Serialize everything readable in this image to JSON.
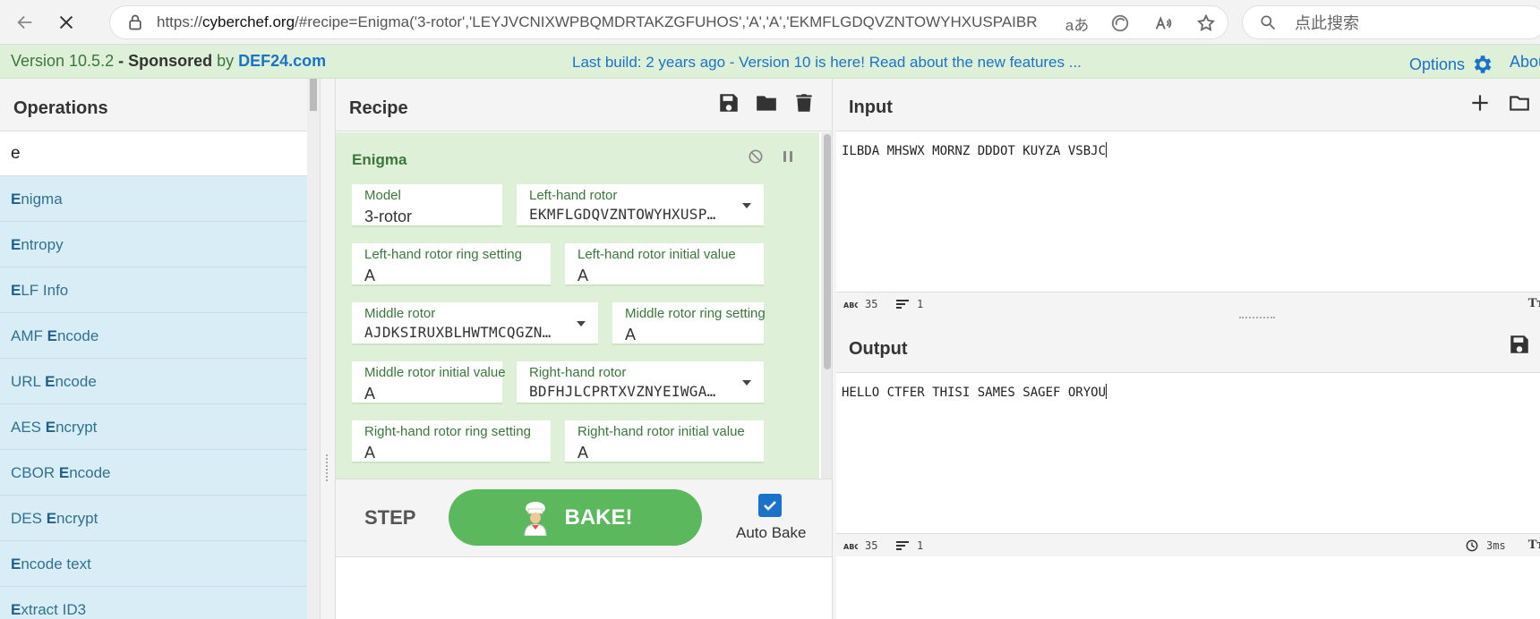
{
  "browser": {
    "url_prefix": "https://",
    "url_host": "cyberchef.org",
    "url_rest": "/#recipe=Enigma('3-rotor','LEYJVCNIXWPBQMDRTAKZGFUHOS','A','A','EKMFLGDQVZNTOWYHXUSPAIBR...",
    "translate_label": "aあ",
    "search_placeholder": "点此搜索"
  },
  "banner": {
    "version": "Version 10.5.2",
    "sponsored": " - Sponsored",
    "by": " by ",
    "sponsor": "DEF24.com",
    "build_notice": "Last build: 2 years ago - Version 10 is here! Read about the new features ...",
    "options": "Options",
    "about": "Abou"
  },
  "operations": {
    "title": "Operations",
    "search_value": "e",
    "items": [
      {
        "pre": "",
        "hl": "E",
        "post": "nigma"
      },
      {
        "pre": "",
        "hl": "E",
        "post": "ntropy"
      },
      {
        "pre": "",
        "hl": "E",
        "post": "LF Info"
      },
      {
        "pre": "AMF ",
        "hl": "E",
        "post": "ncode"
      },
      {
        "pre": "URL ",
        "hl": "E",
        "post": "ncode"
      },
      {
        "pre": "AES ",
        "hl": "E",
        "post": "ncrypt"
      },
      {
        "pre": "CBOR ",
        "hl": "E",
        "post": "ncode"
      },
      {
        "pre": "DES ",
        "hl": "E",
        "post": "ncrypt"
      },
      {
        "pre": "",
        "hl": "E",
        "post": "ncode text"
      },
      {
        "pre": "",
        "hl": "E",
        "post": "xtract ID3"
      }
    ]
  },
  "recipe": {
    "title": "Recipe",
    "operation_name": "Enigma",
    "fields": {
      "model": {
        "label": "Model",
        "value": "3-rotor"
      },
      "left_rotor": {
        "label": "Left-hand rotor",
        "value": "EKMFLGDQVZNTOWYHXUSP…"
      },
      "left_ring": {
        "label": "Left-hand rotor ring setting",
        "value": "A"
      },
      "left_initial": {
        "label": "Left-hand rotor initial value",
        "value": "A"
      },
      "middle_rotor": {
        "label": "Middle rotor",
        "value": "AJDKSIRUXBLHWTMCQGZN…"
      },
      "middle_ring": {
        "label": "Middle rotor ring setting",
        "value": "A"
      },
      "middle_initial": {
        "label": "Middle rotor initial value",
        "value": "A"
      },
      "right_rotor": {
        "label": "Right-hand rotor",
        "value": "BDFHJLCPRTXVZNYEIWGA…"
      },
      "right_ring": {
        "label": "Right-hand rotor ring setting",
        "value": "A"
      },
      "right_initial": {
        "label": "Right-hand rotor initial value",
        "value": "A"
      }
    },
    "step_label": "STEP",
    "bake_label": "BAKE!",
    "auto_bake_label": "Auto Bake",
    "auto_bake_checked": true
  },
  "input": {
    "title": "Input",
    "text": "ILBDA MHSWX MORNZ DDDOT KUYZA VSBJC",
    "char_count": "35",
    "line_count": "1"
  },
  "output": {
    "title": "Output",
    "text": "HELLO CTFER THISI SAMES SAGEF ORYOU",
    "char_count": "35",
    "line_count": "1",
    "bake_time": "3ms"
  },
  "colors": {
    "accent_blue": "#1a73c8",
    "bake_green": "#5cb85c",
    "op_card_bg": "#dff0d8",
    "op_list_bg": "#d9edf7"
  }
}
